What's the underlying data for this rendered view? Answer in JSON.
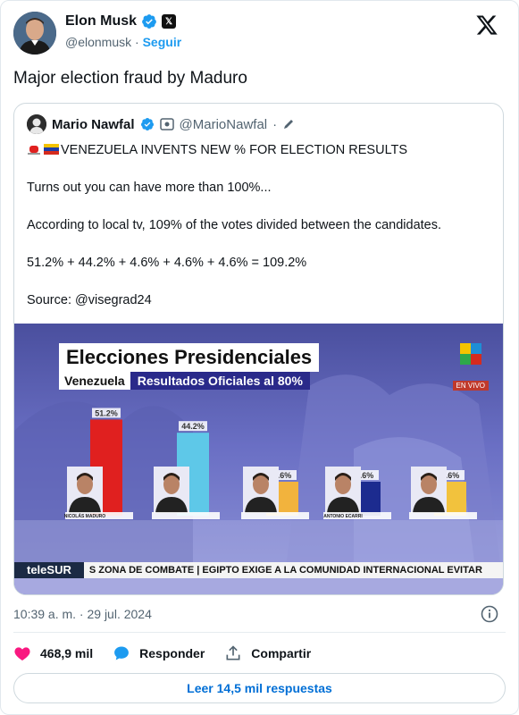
{
  "author": {
    "name": "Elon Musk",
    "handle": "@elonmusk",
    "separator": "·",
    "follow_label": "Seguir"
  },
  "tweet_text": "Major election fraud by Maduro",
  "quoted": {
    "name": "Mario Nawfal",
    "handle": "@MarioNawfal",
    "separator": "·",
    "line1": "VENEZUELA INVENTS NEW % FOR ELECTION RESULTS",
    "line2": "Turns out you can have more than 100%...",
    "line3": "According to local tv, 109% of the votes divided between the candidates.",
    "line4": "51.2% + 44.2% + 4.6% + 4.6% + 4.6% = 109.2%",
    "line5": "Source: @visegrad24"
  },
  "media": {
    "title": "Elecciones Presidenciales",
    "country": "Venezuela",
    "subtitle": "Resultados Oficiales al 80%",
    "live_label": "EN VIVO",
    "ticker_brand": "teleSUR",
    "ticker_text": "S ZONA DE COMBATE  |  EGIPTO EXIGE A LA COMUNIDAD INTERNACIONAL EVITAR"
  },
  "chart_data": {
    "type": "bar",
    "title": "Elecciones Presidenciales",
    "subtitle": "Resultados Oficiales al 80%",
    "value_labels": [
      "51.2%",
      "44.2%",
      "4.6%",
      "4.6%",
      "4.6%"
    ],
    "values": [
      51.2,
      44.2,
      4.6,
      4.6,
      4.6
    ],
    "candidate_labels": [
      "NICOLÁS MADURO",
      "",
      "",
      "ANTONIO ECARRI",
      ""
    ],
    "colors": [
      "#e0201f",
      "#5ec8e8",
      "#f2b33d",
      "#1c2b8f",
      "#f2c23d"
    ]
  },
  "footer": {
    "timestamp": "10:39 a. m. · 29 jul. 2024",
    "likes": "468,9 mil",
    "reply_label": "Responder",
    "share_label": "Compartir",
    "read_replies": "Leer 14,5 mil respuestas"
  },
  "colors": {
    "accent": "#1d9bf0",
    "like": "#f91880"
  }
}
